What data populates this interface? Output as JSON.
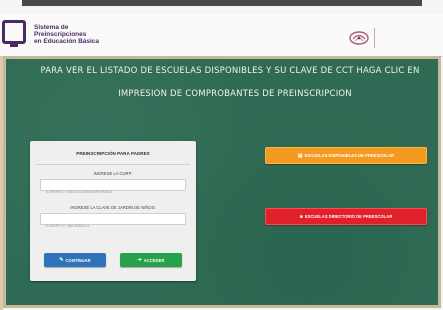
{
  "top_strip": {
    "visible": true
  },
  "header": {
    "brand_lines": [
      "Sistema de",
      "Preinscripciones",
      "en Educación Básica"
    ],
    "gov_text_lines": [
      "",
      "",
      ""
    ],
    "colors": {
      "brand": "#4b2a63",
      "gov": "#7a3b52"
    }
  },
  "board": {
    "line1": "PARA VER EL LISTADO DE ESCUELAS DISPONIBLES Y SU CLAVE DE CCT HAGA CLIC EN",
    "line2": "IMPRESION DE COMPROBANTES DE PREINSCRIPCION",
    "color": "#2f6b54"
  },
  "form": {
    "title": "PREINSCRIPCIÓN PARA PADRES",
    "curp_label": "INGRESE LA CURP:",
    "curp_placeholder": "EJEMPLO: ABCD123456HDFMNN01",
    "cct_label": "INGRESE LA CLAVE DE JARDÍN DE NIÑOS:",
    "cct_placeholder": "EJEMPLO: 15EJN0001L",
    "btn_continue": "CONTINUAR",
    "btn_access": "ACCEDER"
  },
  "actions": {
    "orange_label": "ESCUELAS DISPONIBLES DE PREESCOLAR",
    "red_label": "ESCUELAS DIRECTORIO DE PREESCOLAR",
    "colors": {
      "orange": "#f39a21",
      "red": "#e0202a",
      "blue": "#2f73b8",
      "green": "#27a24a"
    }
  }
}
